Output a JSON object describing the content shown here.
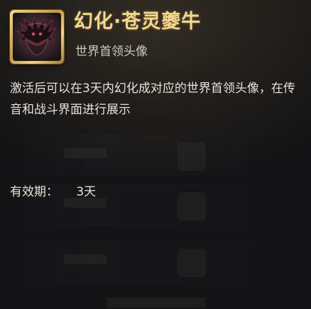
{
  "item": {
    "title": "幻化·苍灵夔牛",
    "subtitle": "世界首领头像",
    "icon": "world-boss-avatar-portrait",
    "description": "激活后可以在3天内幻化成对应的世界首领头像，在传音和战斗界面进行展示",
    "duration_label": "有效期：",
    "duration_value": "3天"
  },
  "colors": {
    "title": "#f2d78f",
    "frame_gold": "#d8b25a",
    "text": "#e7e1d6",
    "subtext": "#cfc9bd"
  }
}
